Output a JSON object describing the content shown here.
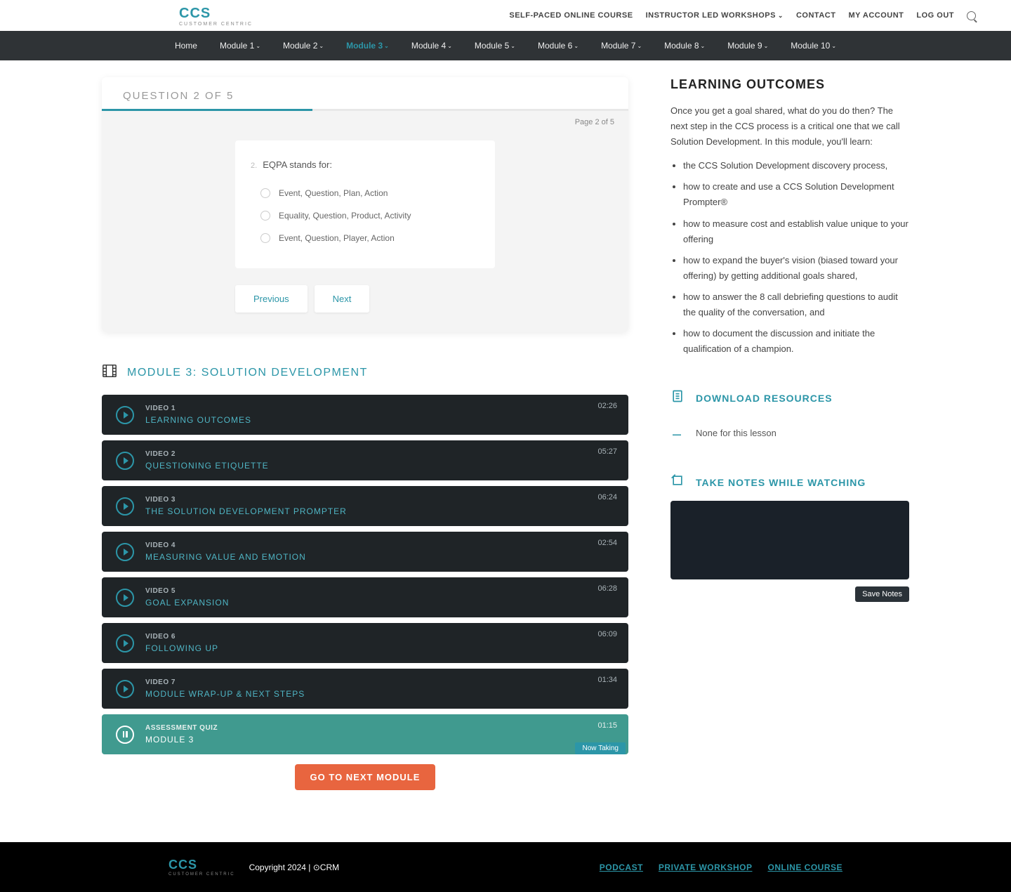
{
  "header": {
    "logo_main": "CCS",
    "logo_sub": "CUSTOMER CENTRIC",
    "nav": {
      "self_paced": "SELF-PACED ONLINE COURSE",
      "workshops": "INSTRUCTOR LED WORKSHOPS",
      "contact": "CONTACT",
      "account": "MY ACCOUNT",
      "logout": "LOG OUT"
    }
  },
  "module_nav": {
    "home": "Home",
    "items": [
      {
        "label": "Module 1"
      },
      {
        "label": "Module 2"
      },
      {
        "label": "Module 3"
      },
      {
        "label": "Module 4"
      },
      {
        "label": "Module 5"
      },
      {
        "label": "Module 6"
      },
      {
        "label": "Module 7"
      },
      {
        "label": "Module 8"
      },
      {
        "label": "Module 9"
      },
      {
        "label": "Module 10"
      }
    ],
    "active_index": 2
  },
  "quiz": {
    "header": "QUESTION 2 OF 5",
    "page_info": "Page 2 of 5",
    "q_number": "2.",
    "q_text": "EQPA stands for:",
    "options": [
      "Event, Question, Plan, Action",
      "Equality, Question, Product, Activity",
      "Event, Question, Player, Action"
    ],
    "prev": "Previous",
    "next": "Next"
  },
  "module_section": {
    "title": "MODULE 3: SOLUTION DEVELOPMENT",
    "videos": [
      {
        "label": "VIDEO 1",
        "name": "LEARNING OUTCOMES",
        "time": "02:26"
      },
      {
        "label": "VIDEO 2",
        "name": "QUESTIONING ETIQUETTE",
        "time": "05:27"
      },
      {
        "label": "VIDEO 3",
        "name": "THE SOLUTION DEVELOPMENT PROMPTER",
        "time": "06:24"
      },
      {
        "label": "VIDEO 4",
        "name": "MEASURING VALUE AND EMOTION",
        "time": "02:54"
      },
      {
        "label": "VIDEO 5",
        "name": "GOAL EXPANSION",
        "time": "06:28"
      },
      {
        "label": "VIDEO 6",
        "name": "FOLLOWING UP",
        "time": "06:09"
      },
      {
        "label": "VIDEO 7",
        "name": "MODULE WRAP-UP & NEXT STEPS",
        "time": "01:34"
      }
    ],
    "quiz_item": {
      "label": "ASSESSMENT QUIZ",
      "name": "MODULE 3",
      "time": "01:15",
      "badge": "Now Taking"
    },
    "next_btn": "GO TO NEXT MODULE"
  },
  "outcomes": {
    "title": "LEARNING OUTCOMES",
    "intro": "Once you get a goal shared, what do you do then? The next step in the CCS process is a critical one that we call Solution Development. In this module, you'll learn:",
    "items": [
      "the CCS Solution Development discovery process,",
      "how to create and use a CCS Solution Development Prompter®",
      "how to measure cost and establish value unique to your offering",
      "how to expand the buyer's vision (biased toward your offering) by getting additional goals shared,",
      "how to answer the 8 call debriefing questions to audit the quality of the conversation, and",
      "how to document the discussion and initiate the qualification of a champion."
    ]
  },
  "resources": {
    "download_label": "DOWNLOAD RESOURCES",
    "none_text": "None for this lesson"
  },
  "notes": {
    "label": "TAKE NOTES WHILE WATCHING",
    "save": "Save Notes"
  },
  "footer": {
    "copyright": "Copyright 2024 | ",
    "crm": "⊙CRM",
    "links": {
      "podcast": "PODCAST",
      "workshop": "PRIVATE WORKSHOP",
      "course": "ONLINE COURSE"
    }
  }
}
